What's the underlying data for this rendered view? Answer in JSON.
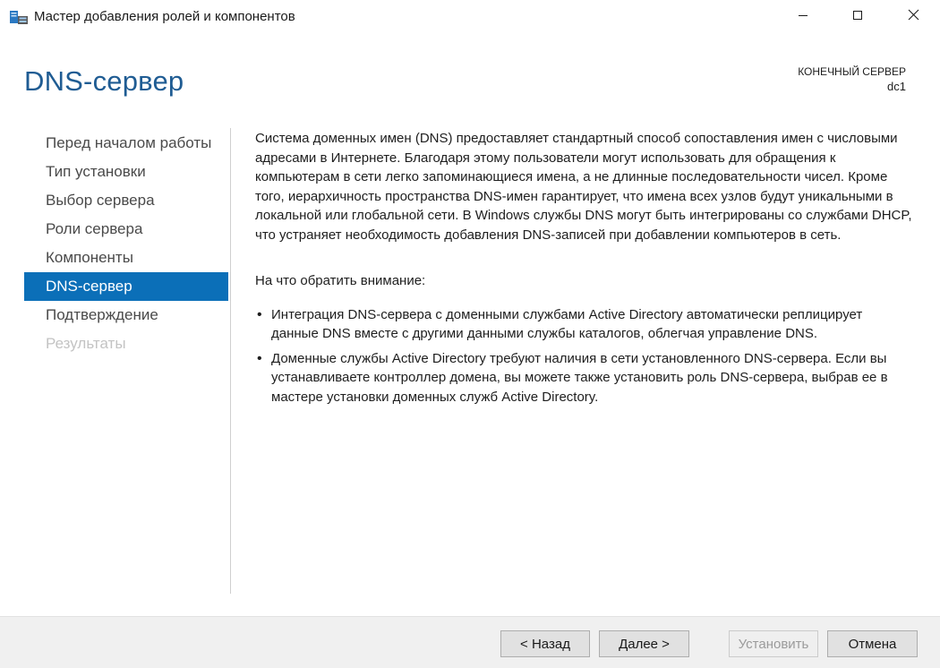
{
  "window": {
    "title": "Мастер добавления ролей и компонентов",
    "icon": "server-manager-icon",
    "controls": [
      "minimize-icon",
      "maximize-icon",
      "close-icon"
    ]
  },
  "header": {
    "page_title": "DNS-сервер",
    "server_label": "КОНЕЧНЫЙ СЕРВЕР",
    "server_name": "dc1"
  },
  "nav": {
    "items": [
      {
        "label": "Перед началом работы",
        "state": "normal"
      },
      {
        "label": "Тип установки",
        "state": "normal"
      },
      {
        "label": "Выбор сервера",
        "state": "normal"
      },
      {
        "label": "Роли сервера",
        "state": "normal"
      },
      {
        "label": "Компоненты",
        "state": "normal"
      },
      {
        "label": "DNS-сервер",
        "state": "active"
      },
      {
        "label": "Подтверждение",
        "state": "normal"
      },
      {
        "label": "Результаты",
        "state": "disabled"
      }
    ]
  },
  "content": {
    "description": "Система доменных имен (DNS) предоставляет стандартный способ сопоставления имен с числовыми адресами в Интернете. Благодаря этому пользователи могут использовать для обращения к компьютерам в сети легко запоминающиеся имена, а не длинные последовательности чисел. Кроме того, иерархичность пространства DNS-имен гарантирует, что имена всех узлов будут уникальными в локальной или глобальной сети. В Windows службы DNS могут быть интегрированы со службами DHCP, что устраняет необходимость добавления DNS-записей при добавлении компьютеров в сеть.",
    "consider_heading": "На что обратить внимание:",
    "bullets": [
      "Интеграция DNS-сервера с доменными службами Active Directory автоматически реплицирует данные DNS вместе с другими данными службы каталогов, облегчая управление DNS.",
      "Доменные службы Active Directory требуют наличия в сети установленного DNS-сервера. Если вы устанавливаете контроллер домена, вы можете также установить роль DNS-сервера, выбрав ее в мастере установки доменных служб Active Directory."
    ]
  },
  "footer": {
    "back_label": "< Назад",
    "next_label": "Далее >",
    "install_label": "Установить",
    "cancel_label": "Отмена"
  },
  "colors": {
    "accent": "#0b6fb8",
    "title": "#1f5c93",
    "disabled_text": "#c3c3c3"
  }
}
